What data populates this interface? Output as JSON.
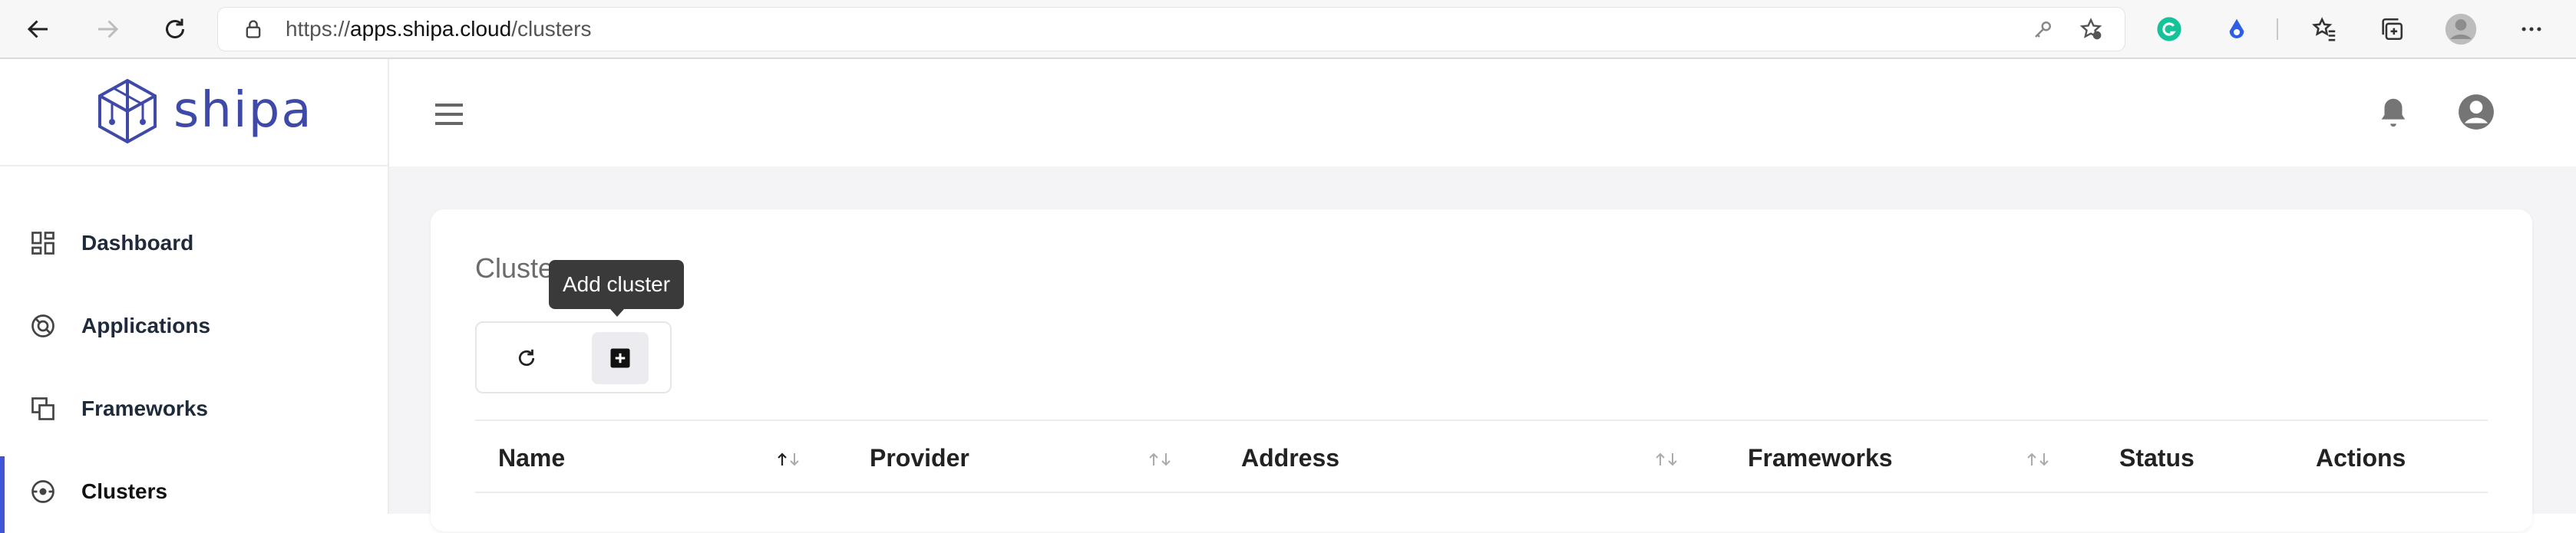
{
  "browser": {
    "url_scheme": "https://",
    "url_host": "apps.shipa.cloud",
    "url_path": "/clusters",
    "icons": [
      "back-icon",
      "forward-icon",
      "refresh-icon",
      "lock-icon",
      "key-icon",
      "favorite-add-icon",
      "grammarly-icon",
      "extension-icon",
      "favorites-icon",
      "collections-icon",
      "profile-icon",
      "more-icon"
    ]
  },
  "brand": {
    "name": "shipa"
  },
  "sidebar": {
    "items": [
      {
        "label": "Dashboard",
        "icon": "dashboard-icon",
        "active": false
      },
      {
        "label": "Applications",
        "icon": "applications-icon",
        "active": false
      },
      {
        "label": "Frameworks",
        "icon": "frameworks-icon",
        "active": false
      },
      {
        "label": "Clusters",
        "icon": "clusters-icon",
        "active": true
      }
    ]
  },
  "header": {
    "icons": [
      "menu-icon",
      "notifications-icon",
      "account-icon"
    ]
  },
  "main": {
    "title": "Clusters",
    "toolbar": {
      "refresh_icon": "refresh-icon",
      "add_icon": "add-box-icon",
      "tooltip": "Add cluster"
    },
    "table": {
      "columns": [
        {
          "label": "Name",
          "sortable": true,
          "sort": "asc"
        },
        {
          "label": "Provider",
          "sortable": true,
          "sort": "none"
        },
        {
          "label": "Address",
          "sortable": true,
          "sort": "none"
        },
        {
          "label": "Frameworks",
          "sortable": true,
          "sort": "none"
        },
        {
          "label": "Status",
          "sortable": false
        },
        {
          "label": "Actions",
          "sortable": false
        }
      ]
    }
  },
  "colors": {
    "accent": "#3f55d6",
    "brand": "#3f4aa8",
    "content_bg": "#f4f4f7"
  }
}
